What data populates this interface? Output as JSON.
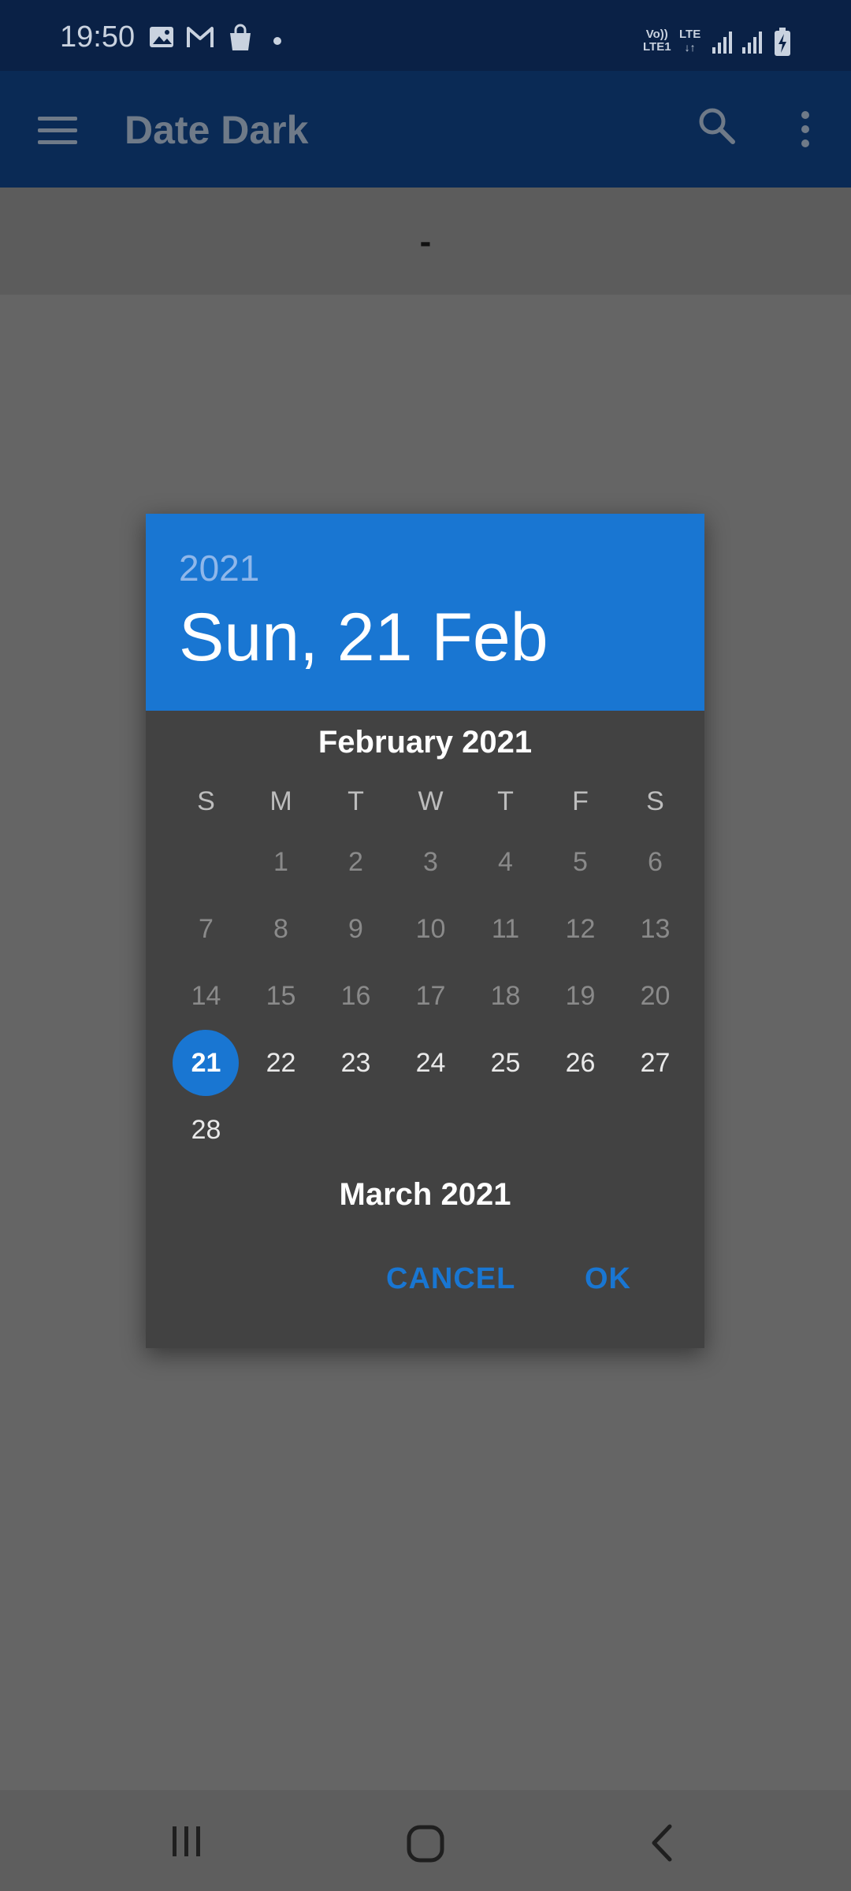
{
  "status_bar": {
    "time": "19:50",
    "left_icons": [
      "image-icon",
      "gmail-icon",
      "shopping-bag-icon",
      "dot-icon"
    ],
    "right_icons": [
      "volte-icon",
      "lte-icon",
      "signal-icon",
      "signal-icon",
      "battery-charging-icon"
    ],
    "volte_label": "Vo))",
    "lte1_label": "LTE1",
    "lte_label": "LTE"
  },
  "app_bar": {
    "title": "Date Dark",
    "menu_icon": "hamburger-icon",
    "search_icon": "search-icon",
    "more_icon": "more-vert-icon"
  },
  "date_display": {
    "value": "-"
  },
  "dialog": {
    "year": "2021",
    "selected_date": "Sun, 21 Feb",
    "month_title": "February 2021",
    "next_month_title": "March 2021",
    "weekdays": [
      "S",
      "M",
      "T",
      "W",
      "T",
      "F",
      "S"
    ],
    "weeks": [
      [
        "",
        "1",
        "2",
        "3",
        "4",
        "5",
        "6"
      ],
      [
        "7",
        "8",
        "9",
        "10",
        "11",
        "12",
        "13"
      ],
      [
        "14",
        "15",
        "16",
        "17",
        "18",
        "19",
        "20"
      ],
      [
        "21",
        "22",
        "23",
        "24",
        "25",
        "26",
        "27"
      ],
      [
        "28",
        "",
        "",
        "",
        "",
        "",
        ""
      ]
    ],
    "selected_day": "21",
    "cancel_label": "CANCEL",
    "ok_label": "OK",
    "accent_color": "#1976d2"
  },
  "nav_bar": {
    "icons": [
      "recents-icon",
      "home-icon",
      "back-icon"
    ]
  }
}
